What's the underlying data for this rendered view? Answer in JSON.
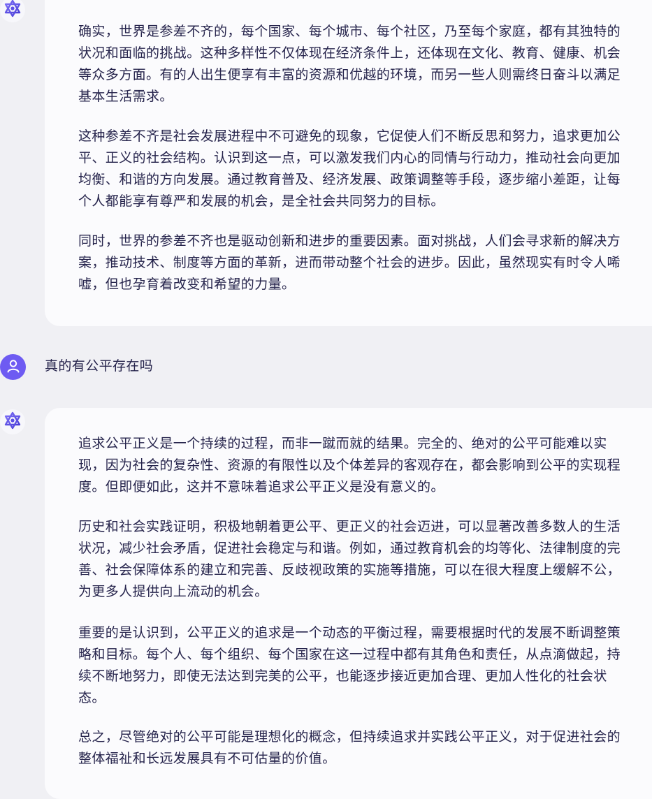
{
  "conversation": {
    "ai_message_1": {
      "paragraphs": [
        "确实，世界是参差不齐的，每个国家、每个城市、每个社区，乃至每个家庭，都有其独特的状况和面临的挑战。这种多样性不仅体现在经济条件上，还体现在文化、教育、健康、机会等众多方面。有的人出生便享有丰富的资源和优越的环境，而另一些人则需终日奋斗以满足基本生活需求。",
        "这种参差不齐是社会发展进程中不可避免的现象，它促使人们不断反思和努力，追求更加公平、正义的社会结构。认识到这一点，可以激发我们内心的同情与行动力，推动社会向更加均衡、和谐的方向发展。通过教育普及、经济发展、政策调整等手段，逐步缩小差距，让每个人都能享有尊严和发展的机会，是全社会共同努力的目标。",
        "同时，世界的参差不齐也是驱动创新和进步的重要因素。面对挑战，人们会寻求新的解决方案，推动技术、制度等方面的革新，进而带动整个社会的进步。因此，虽然现实有时令人唏嘘，但也孕育着改变和希望的力量。"
      ]
    },
    "user_message": {
      "text": "真的有公平存在吗"
    },
    "ai_message_2": {
      "paragraphs": [
        "追求公平正义是一个持续的过程，而非一蹴而就的结果。完全的、绝对的公平可能难以实现，因为社会的复杂性、资源的有限性以及个体差异的客观存在，都会影响到公平的实现程度。但即便如此，这并不意味着追求公平正义是没有意义的。",
        "历史和社会实践证明，积极地朝着更公平、更正义的社会迈进，可以显著改善多数人的生活状况，减少社会矛盾，促进社会稳定与和谐。例如，通过教育机会的均等化、法律制度的完善、社会保障体系的建立和完善、反歧视政策的实施等措施，可以在很大程度上缓解不公，为更多人提供向上流动的机会。",
        "重要的是认识到，公平正义的追求是一个动态的平衡过程，需要根据时代的发展不断调整策略和目标。每个人、每个组织、每个国家在这一过程中都有其角色和责任，从点滴做起，持续不断地努力，即使无法达到完美的公平，也能逐步接近更加合理、更加人性化的社会状态。",
        "总之，尽管绝对的公平可能是理想化的概念，但持续追求并实践公平正义，对于促进社会的整体福祉和长远发展具有不可估量的价值。"
      ]
    }
  },
  "icons": {
    "ai_avatar": "assistant-logo-icon",
    "user_avatar": "user-avatar-icon"
  },
  "colors": {
    "page_background": "#f0f0f4",
    "bubble_background": "#fbfbfd",
    "text": "#26244c",
    "accent": "#6e5bf2"
  }
}
